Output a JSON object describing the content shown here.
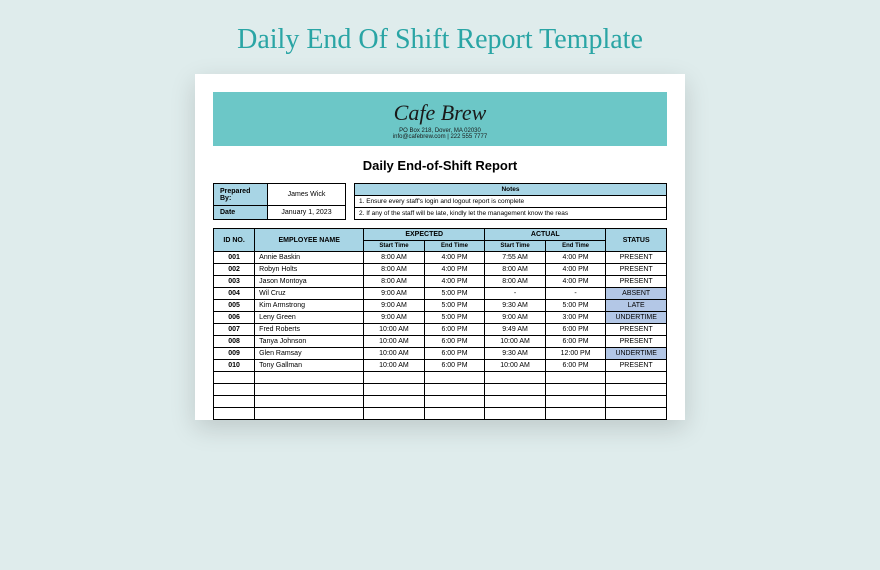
{
  "page_title": "Daily End Of Shift Report Template",
  "banner": {
    "brand": "Cafe Brew",
    "address": "PO Box 218, Dover, MA 02030",
    "contact": "info@cafebrew.com | 222 555 7777"
  },
  "report_title": "Daily End-of-Shift Report",
  "meta": {
    "prepared_by_label": "Prepared By:",
    "prepared_by_value": "James Wick",
    "date_label": "Date",
    "date_value": "January 1, 2023",
    "notes_label": "Notes",
    "note1": "1. Ensure every staff's login and logout report is complete",
    "note2": "2. If any of the staff will be late, kindly let the management know the reas"
  },
  "headers": {
    "id": "ID NO.",
    "name": "EMPLOYEE NAME",
    "expected": "EXPECTED",
    "actual": "ACTUAL",
    "status": "STATUS",
    "start": "Start Time",
    "end": "End Time"
  },
  "rows": [
    {
      "id": "001",
      "name": "Annie Baskin",
      "es": "8:00 AM",
      "ee": "4:00 PM",
      "as": "7:55 AM",
      "ae": "4:00 PM",
      "status": "PRESENT",
      "flag": false
    },
    {
      "id": "002",
      "name": "Robyn Holts",
      "es": "8:00 AM",
      "ee": "4:00 PM",
      "as": "8:00 AM",
      "ae": "4:00 PM",
      "status": "PRESENT",
      "flag": false
    },
    {
      "id": "003",
      "name": "Jason Montoya",
      "es": "8:00 AM",
      "ee": "4:00 PM",
      "as": "8:00 AM",
      "ae": "4:00 PM",
      "status": "PRESENT",
      "flag": false
    },
    {
      "id": "004",
      "name": "Wil Cruz",
      "es": "9:00 AM",
      "ee": "5:00 PM",
      "as": "-",
      "ae": "-",
      "status": "ABSENT",
      "flag": true
    },
    {
      "id": "005",
      "name": "Kim Armstrong",
      "es": "9:00 AM",
      "ee": "5:00 PM",
      "as": "9:30 AM",
      "ae": "5:00 PM",
      "status": "LATE",
      "flag": true
    },
    {
      "id": "006",
      "name": "Leny Green",
      "es": "9:00 AM",
      "ee": "5:00 PM",
      "as": "9:00 AM",
      "ae": "3:00 PM",
      "status": "UNDERTIME",
      "flag": true
    },
    {
      "id": "007",
      "name": "Fred Roberts",
      "es": "10:00 AM",
      "ee": "6:00 PM",
      "as": "9:49 AM",
      "ae": "6:00 PM",
      "status": "PRESENT",
      "flag": false
    },
    {
      "id": "008",
      "name": "Tanya Johnson",
      "es": "10:00 AM",
      "ee": "6:00 PM",
      "as": "10:00 AM",
      "ae": "6:00 PM",
      "status": "PRESENT",
      "flag": false
    },
    {
      "id": "009",
      "name": "Glen Ramsay",
      "es": "10:00 AM",
      "ee": "6:00 PM",
      "as": "9:30 AM",
      "ae": "12:00 PM",
      "status": "UNDERTIME",
      "flag": true
    },
    {
      "id": "010",
      "name": "Tony Gallman",
      "es": "10:00 AM",
      "ee": "6:00 PM",
      "as": "10:00 AM",
      "ae": "6:00 PM",
      "status": "PRESENT",
      "flag": false
    }
  ]
}
